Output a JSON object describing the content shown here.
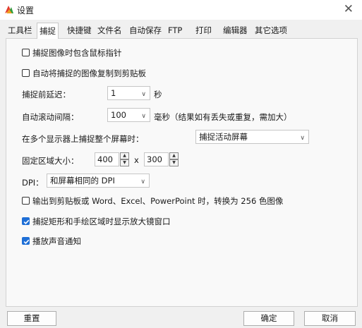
{
  "window": {
    "title": "设置",
    "close_glyph": "✕",
    "icon": "app-logo-icon"
  },
  "tabs": [
    {
      "label": "工具栏"
    },
    {
      "label": "捕捉",
      "active": true
    },
    {
      "label": "快捷键"
    },
    {
      "label": "文件名"
    },
    {
      "label": "自动保存"
    },
    {
      "label": "FTP"
    },
    {
      "label": "打印"
    },
    {
      "label": "编辑器"
    },
    {
      "label": "其它选项"
    }
  ],
  "options": {
    "include_cursor": {
      "label": "捕捉图像时包含鼠标指针",
      "checked": false
    },
    "copy_to_clipboard": {
      "label": "自动将捕捉的图像复制到剪贴板",
      "checked": false
    },
    "delay": {
      "label": "捕捉前延迟：",
      "value": "1",
      "unit": "秒"
    },
    "scroll": {
      "label": "自动滚动间隔：",
      "value": "100",
      "unit": "毫秒（结果如有丢失或重复，需加大）"
    },
    "multi_monitor": {
      "label": "在多个显示器上捕捉整个屏幕时：",
      "value": "捕捉活动屏幕"
    },
    "fixed_region": {
      "label": "固定区域大小：",
      "width": "400",
      "sep": "x",
      "height": "300"
    },
    "dpi": {
      "label": "DPI：",
      "value": "和屏幕相同的 DPI"
    },
    "convert_256": {
      "label": "输出到剪贴板或 Word、Excel、PowerPoint 时，转换为 256 色图像",
      "checked": false
    },
    "magnifier": {
      "label": "捕捉矩形和手绘区域时显示放大镜窗口",
      "checked": true
    },
    "sound": {
      "label": "播放声音通知",
      "checked": true
    }
  },
  "buttons": {
    "reset": "重置",
    "ok": "确定",
    "cancel": "取消"
  },
  "colors": {
    "accent": "#1f6fd6"
  }
}
